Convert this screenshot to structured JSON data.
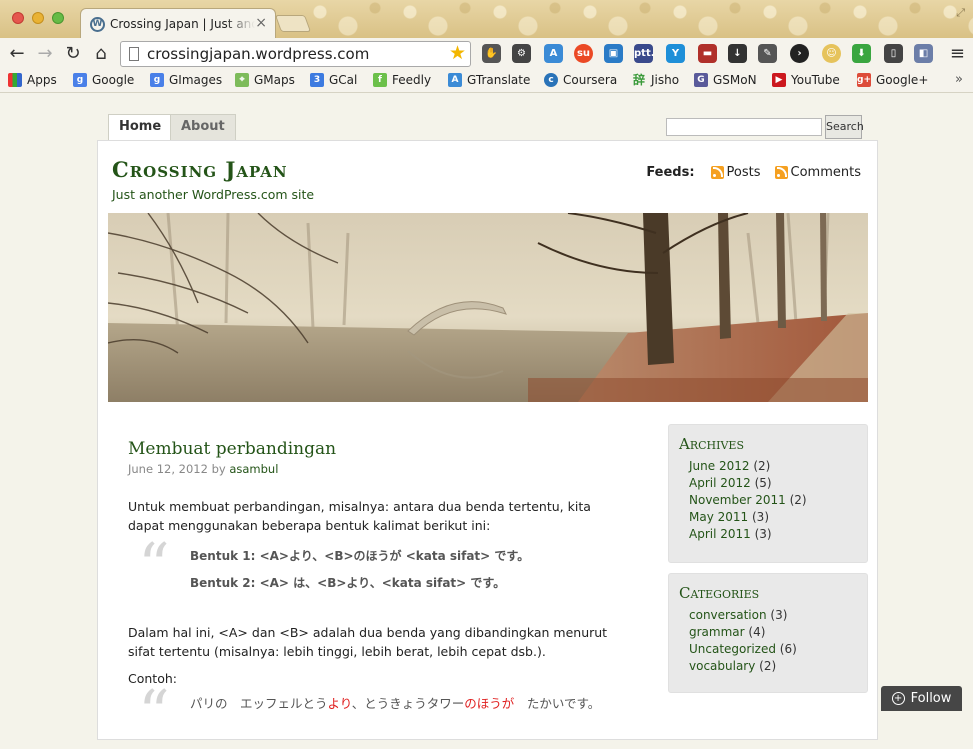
{
  "browser": {
    "tab_title": "Crossing Japan | Just another WordPress.com site",
    "url": "crossingjapan.wordpress.com",
    "bookmarks": [
      "Apps",
      "Google",
      "GImages",
      "GMaps",
      "GCal",
      "Feedly",
      "GTranslate",
      "Coursera",
      "Jisho",
      "GSMoN",
      "YouTube",
      "Google+"
    ],
    "bookmark_more": "»",
    "extensions": [
      "ptt."
    ],
    "colors": {
      "accent_star": "#f3b600"
    }
  },
  "nav": {
    "tabs": [
      "Home",
      "About"
    ],
    "search_button": "Search"
  },
  "site": {
    "title": "Crossing Japan",
    "tagline": "Just another WordPress.com site",
    "feeds_label": "Feeds:",
    "feeds": [
      "Posts",
      "Comments"
    ]
  },
  "post": {
    "title": "Membuat perbandingan",
    "date": "June 12, 2012",
    "by": "by",
    "author": "asambul",
    "intro": "Untuk membuat perbandingan, misalnya: antara dua benda tertentu, kita dapat menggunakan beberapa bentuk kalimat berikut ini:",
    "pattern1": "Bentuk 1: <A>より、<B>のほうが <kata sifat> です。",
    "pattern2": "Bentuk 2:  <A> は、<B>より、<kata sifat> です。",
    "para2": "Dalam hal ini, <A> dan <B> adalah dua benda yang dibandingkan menurut sifat tertentu (misalnya: lebih tinggi, lebih berat, lebih cepat dsb.).",
    "contoh": "Contoh:",
    "example_a": "パリの　エッフェルとう",
    "example_yori": "より",
    "example_b": "、とうきょうタワー",
    "example_nohouga": "のほうが",
    "example_c": "　たかいです。"
  },
  "sidebar": {
    "archives_title": "Archives",
    "archives": [
      {
        "label": "June 2012",
        "count": "(2)"
      },
      {
        "label": "April 2012",
        "count": "(5)"
      },
      {
        "label": "November 2011",
        "count": "(2)"
      },
      {
        "label": "May 2011",
        "count": "(3)"
      },
      {
        "label": "April 2011",
        "count": "(3)"
      }
    ],
    "categories_title": "Categories",
    "categories": [
      {
        "label": "conversation",
        "count": "(3)"
      },
      {
        "label": "grammar",
        "count": "(4)"
      },
      {
        "label": "Uncategorized",
        "count": "(6)"
      },
      {
        "label": "vocabulary",
        "count": "(2)"
      }
    ]
  },
  "follow": "Follow"
}
